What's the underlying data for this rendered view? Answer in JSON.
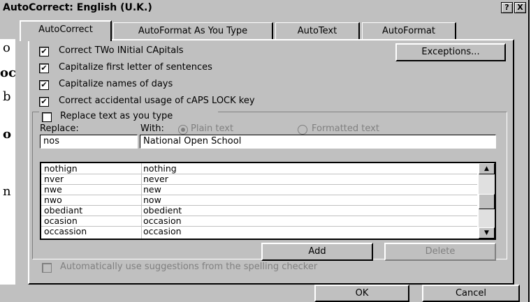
{
  "window": {
    "title": "AutoCorrect: English (U.K.)",
    "help_label": "?",
    "close_label": "X"
  },
  "tabs": [
    {
      "label": "AutoCorrect",
      "active": true
    },
    {
      "label": "AutoFormat As You Type",
      "active": false
    },
    {
      "label": "AutoText",
      "active": false
    },
    {
      "label": "AutoFormat",
      "active": false
    }
  ],
  "options": [
    {
      "label": "Correct TWo INitial CApitals",
      "checked": true
    },
    {
      "label": "Capitalize first letter of sentences",
      "checked": true
    },
    {
      "label": "Capitalize names of days",
      "checked": true
    },
    {
      "label": "Correct accidental usage of cAPS LOCK key",
      "checked": true
    }
  ],
  "exceptions_button": "Exceptions...",
  "replace_group": {
    "checkbox_label": "Replace text as you type",
    "checked": false,
    "replace_label": "Replace:",
    "with_label": "With:",
    "plain_text_label": "Plain text",
    "formatted_text_label": "Formatted text",
    "plain_text_selected": true,
    "replace_value": "nos",
    "with_value": "National Open School"
  },
  "list": {
    "rows": [
      {
        "from": "nothign",
        "to": "nothing"
      },
      {
        "from": "nver",
        "to": "never"
      },
      {
        "from": "nwe",
        "to": "new"
      },
      {
        "from": "nwo",
        "to": "now"
      },
      {
        "from": "obediant",
        "to": "obedient"
      },
      {
        "from": "ocasion",
        "to": "occasion"
      },
      {
        "from": "occassion",
        "to": "occasion"
      }
    ],
    "scroll_up_icon": "▲",
    "scroll_down_icon": "▼"
  },
  "add_button": "Add",
  "delete_button": "Delete",
  "suggestions": {
    "label": "Automatically use suggestions from the spelling checker",
    "checked": false,
    "enabled": false
  },
  "ok_button": "OK",
  "cancel_button": "Cancel",
  "background_doc": {
    "fragments": [
      "o",
      "oc",
      "b",
      "o",
      "n"
    ]
  }
}
